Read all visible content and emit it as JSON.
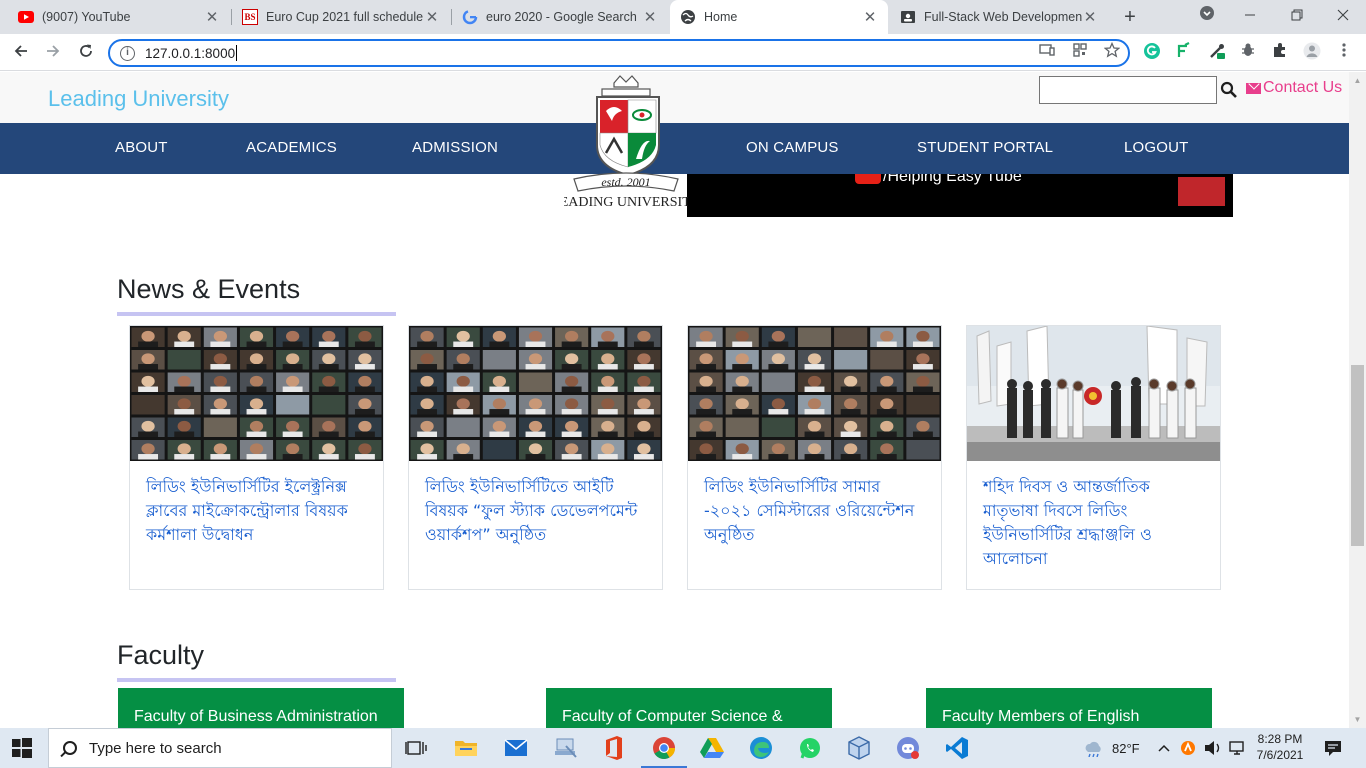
{
  "browser": {
    "tabs": [
      {
        "title": "(9007) YouTube",
        "icon": "youtube-icon"
      },
      {
        "title": "Euro Cup 2021 full schedule,",
        "icon": "business-standard-icon"
      },
      {
        "title": "euro 2020 - Google Search",
        "icon": "google-icon"
      },
      {
        "title": "Home",
        "icon": "globe-icon",
        "active": true
      },
      {
        "title": "Full-Stack Web Development",
        "icon": "document-icon"
      }
    ],
    "favicon_text_bs": "BS",
    "close_glyph": "✕",
    "new_tab_glyph": "+",
    "url": "127.0.0.1:8000"
  },
  "site": {
    "brand": "Leading University",
    "search_placeholder": "",
    "contact_label": "Contact Us",
    "nav": [
      "ABOUT",
      "ACADEMICS",
      "ADMISSION",
      "ON CAMPUS",
      "STUDENT PORTAL",
      "LOGOUT"
    ],
    "logo_text": "estd. 2001",
    "logo_caption": "LEADING UNIVERSITY",
    "video_text": "/Helping Easy Tube",
    "news": {
      "title": "News & Events",
      "items": [
        {
          "title": "লিডিং ইউনিভার্সিটির ইলেক্ট্রনিক্স ক্লাবের মাইক্রোকন্ট্রোলার বিষয়ক কর্মশালা উদ্বোধন"
        },
        {
          "title": "লিডিং ইউনিভার্সিটিতে আইটি বিষয়ক “ফুল স্ট্যাক ডেভেলপমেন্ট ওয়ার্কশপ” অনুষ্ঠিত"
        },
        {
          "title": "লিডিং ইউনিভার্সিটির সামার -২০২১ সেমিস্টারের ওরিয়েন্টেশন অনুষ্ঠিত"
        },
        {
          "title": "শহিদ দিবস ও আন্তর্জাতিক মাতৃভাষা দিবসে লিডিং ইউনিভার্সিটির শ্রদ্ধাঞ্জলি ও আলোচনা"
        }
      ]
    },
    "faculty": {
      "title": "Faculty",
      "items": [
        {
          "title": "Faculty of Business Administration"
        },
        {
          "title": "Faculty of Computer Science &"
        },
        {
          "title": "Faculty Members of English"
        }
      ]
    }
  },
  "taskbar": {
    "search_placeholder": "Type here to search",
    "weather": "82°F",
    "time": "8:28 PM",
    "date": "7/6/2021"
  },
  "colors": {
    "nav_bg": "#24477a",
    "brand": "#5bc0eb",
    "contact": "#e83e8c",
    "news_link": "#1a5fd0",
    "faculty_bg": "#058f44",
    "title_rule": "#c6c4f2"
  }
}
